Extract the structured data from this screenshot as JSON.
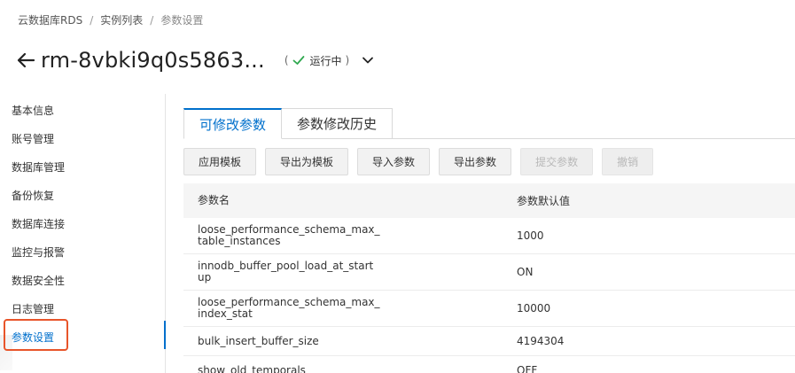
{
  "breadcrumb": [
    "云数据库RDS",
    "实例列表",
    "参数设置"
  ],
  "breadcrumb_separator": "/",
  "header": {
    "title": "rm-8vbki9q0s5863...",
    "status_open": "(",
    "status_label": "运行中",
    "status_close": ")"
  },
  "sidebar": {
    "items": [
      "基本信息",
      "账号管理",
      "数据库管理",
      "备份恢复",
      "数据库连接",
      "监控与报警",
      "数据安全性",
      "日志管理",
      "参数设置"
    ],
    "active_index": 8
  },
  "tabs": [
    "可修改参数",
    "参数修改历史"
  ],
  "toolbar": {
    "apply_template": "应用模板",
    "export_as_template": "导出为模板",
    "import_params": "导入参数",
    "export_params": "导出参数",
    "submit_params": "提交参数",
    "revoke": "撤销"
  },
  "table": {
    "columns": [
      "参数名",
      "参数默认值"
    ],
    "rows": [
      {
        "name_line1": "loose_performance_schema_max_",
        "name_line2": "table_instances",
        "value": "1000"
      },
      {
        "name_line1": "innodb_buffer_pool_load_at_start",
        "name_line2": "up",
        "value": "ON"
      },
      {
        "name_line1": "loose_performance_schema_max_",
        "name_line2": "index_stat",
        "value": "10000"
      },
      {
        "name_line1": "bulk_insert_buffer_size",
        "name_line2": "",
        "value": "4194304"
      },
      {
        "name_line1": "show_old_temporals",
        "name_line2": "",
        "value": "OFF"
      }
    ]
  },
  "colors": {
    "accent": "#0070cc",
    "highlight": "#e8552a",
    "status_check": "#2fa84f"
  },
  "icons": [
    "arrow-left-icon",
    "check-icon",
    "chevron-down-icon"
  ]
}
